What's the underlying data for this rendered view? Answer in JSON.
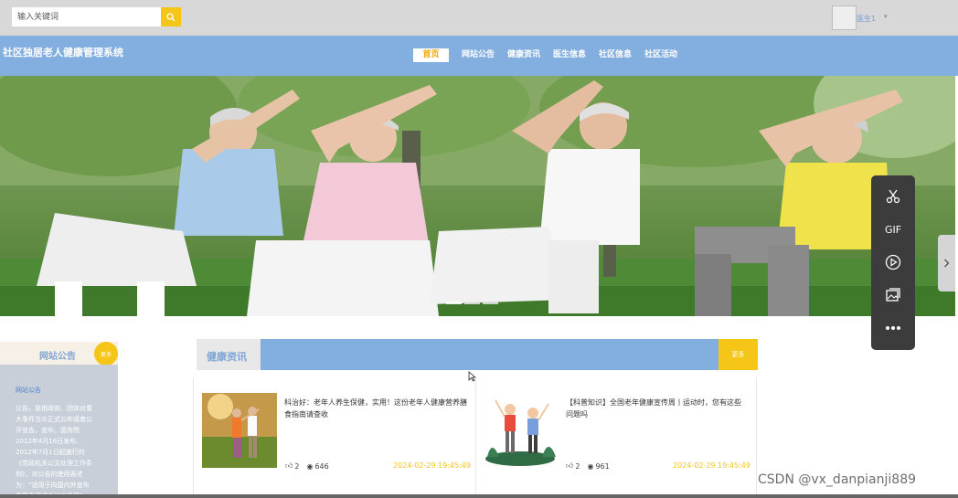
{
  "search": {
    "placeholder": "输入关键词"
  },
  "user": {
    "name": "医生1",
    "caret": "▾"
  },
  "site": {
    "title": "社区独居老人健康管理系统"
  },
  "nav": {
    "items": [
      "首页",
      "网站公告",
      "健康资讯",
      "医生信息",
      "社区信息",
      "社区活动"
    ],
    "active": 0
  },
  "banner": {
    "slides": 3,
    "current": 0
  },
  "notice": {
    "title": "网站公告",
    "more": "更多",
    "link": "网站公告",
    "text": "公告，是指政府、团体对重大事件当众正式公布或者公开宣告，宣布。国务院2012年4月16日发布、2012年7月1日起施行的《党政机关公文处理工作条例》，对公告的使用表述为：“适用于向国内外宣布重要事项或者法定事项”"
  },
  "news": {
    "title": "健康资讯",
    "more": "更多",
    "items": [
      {
        "title": "科治好：老年人养生保健，实用！这份老年人健康营养膳食指南请查收",
        "likes": "2",
        "views": "646",
        "date": "2024-02-29 19:45:49"
      },
      {
        "title": "【科普知识】全国老年健康宣传周丨运动时，您有这些问题吗",
        "likes": "2",
        "views": "961",
        "date": "2024-02-29 19:45:49"
      }
    ]
  },
  "toolbar": {
    "gif_label": "GIF"
  },
  "watermark": "CSDN @vx_danpianji889",
  "colors": {
    "nav": "#82aee0",
    "accent": "#f5c518",
    "topbar": "#d8d8d8"
  }
}
